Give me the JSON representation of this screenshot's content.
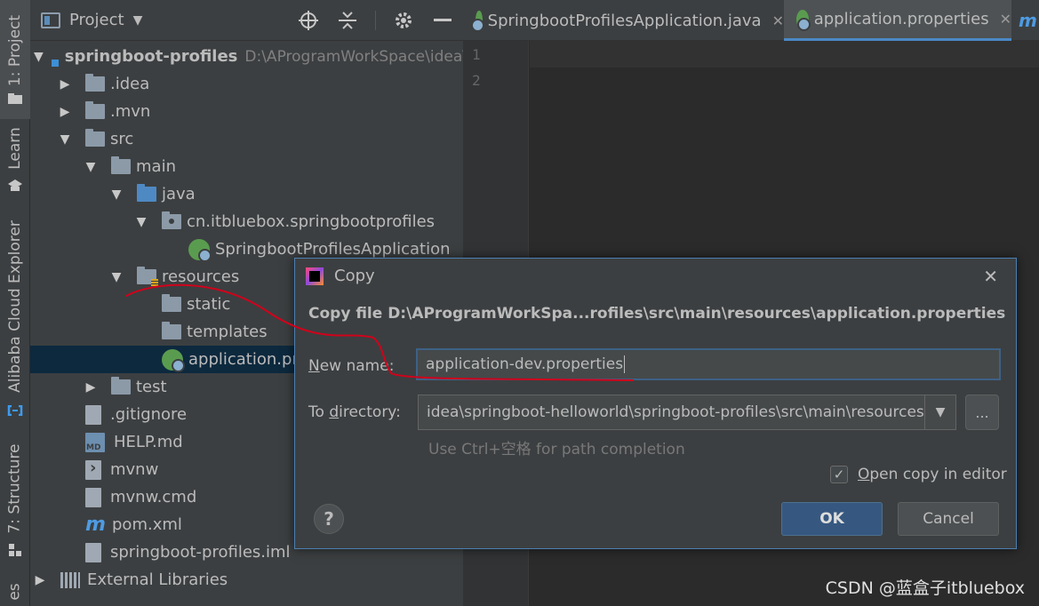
{
  "toolstrip": {
    "project": "1: Project",
    "learn": "Learn",
    "alibaba": "Alibaba Cloud Explorer",
    "structure": "7: Structure",
    "bottom_partial": "es"
  },
  "project_panel": {
    "title": "Project",
    "tree": [
      {
        "label": "springboot-profiles",
        "path": "D:\\AProgramWorkSpace\\idea\\s"
      },
      {
        "label": ".idea"
      },
      {
        "label": ".mvn"
      },
      {
        "label": "src"
      },
      {
        "label": "main"
      },
      {
        "label": "java"
      },
      {
        "label": "cn.itbluebox.springbootprofiles"
      },
      {
        "label": "SpringbootProfilesApplication"
      },
      {
        "label": "resources"
      },
      {
        "label": "static"
      },
      {
        "label": "templates"
      },
      {
        "label": "application.pro"
      },
      {
        "label": "test"
      },
      {
        "label": ".gitignore"
      },
      {
        "label": "HELP.md"
      },
      {
        "label": "mvnw"
      },
      {
        "label": "mvnw.cmd"
      },
      {
        "label": "pom.xml"
      },
      {
        "label": "springboot-profiles.iml"
      },
      {
        "label": "External Libraries"
      }
    ]
  },
  "editor": {
    "tabs": [
      {
        "label": "SpringbootProfilesApplication.java"
      },
      {
        "label": "application.properties"
      }
    ],
    "line_numbers": [
      "1",
      "2"
    ],
    "overflow_marker": "m"
  },
  "dialog": {
    "title": "Copy",
    "headline": "Copy file D:\\AProgramWorkSpa...rofiles\\src\\main\\resources\\application.properties",
    "new_name_label_pre": "N",
    "new_name_label_mid": "ew name",
    "new_name_label_post": ":",
    "new_name_value": "application-dev.properties",
    "to_dir_label_pre": "To ",
    "to_dir_label_mid": "d",
    "to_dir_label_post": "irectory:",
    "to_dir_value": "idea\\springboot-helloworld\\springboot-profiles\\src\\main\\resources",
    "dots": "...",
    "hint": "Use Ctrl+空格 for path completion",
    "open_copy_checked": true,
    "open_copy_pre": "O",
    "open_copy_post": "pen copy in editor",
    "help": "?",
    "ok": "OK",
    "cancel": "Cancel"
  },
  "watermark": "CSDN @蓝盒子itbluebox",
  "colors": {
    "accent": "#4a88c7",
    "selection": "#0d293e",
    "annotation": "#d0021b"
  }
}
